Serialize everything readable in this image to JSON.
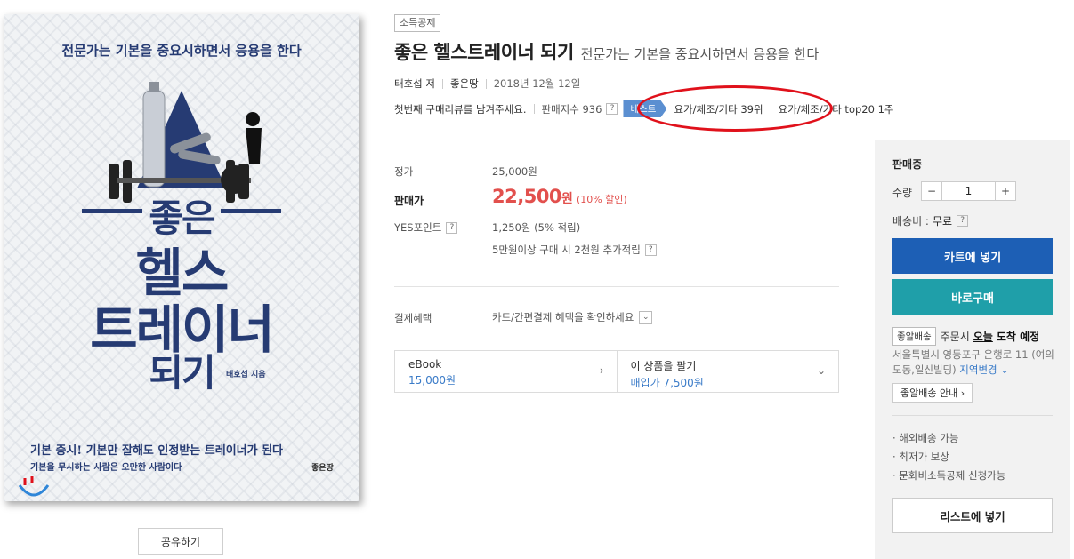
{
  "cover": {
    "subtitle": "전문가는 기본을 중요시하면서 응용을 한다",
    "title_lines": [
      "좋은",
      "헬스",
      "트레이너",
      "되기"
    ],
    "author_credit": "태호섭 지음",
    "tagline": "기본 중시! 기본만 잘해도 인정받는 트레이너가 된다",
    "tagline_sub": "기본을 무시하는 사람은 오만한 사람이다",
    "publisher_logo": "좋은땅",
    "colors": {
      "navy": "#263b73",
      "background": "#f1f3f5"
    }
  },
  "share_label": "공유하기",
  "product": {
    "badge": "소득공제",
    "title": "좋은 헬스트레이너 되기",
    "subtitle": "전문가는 기본을 중요시하면서 응용을 한다",
    "author": "태호섭 저",
    "publisher": "좋은땅",
    "date": "2018년 12월 12일",
    "review_prompt": "첫번째 구매리뷰를 남겨주세요.",
    "sales_index": "판매지수 936",
    "best_label": "베스트",
    "rank_text": "요가/체조/기타 39위",
    "top_text": "요가/체조/기타 top20 1주",
    "help_icon": "?"
  },
  "price": {
    "list_label": "정가",
    "list_value": "25,000원",
    "sale_label": "판매가",
    "sale_value": "22,500",
    "sale_unit": "원",
    "discount": "(10% 할인)",
    "points_label": "YES포인트",
    "points_value": "1,250원 (5% 적립)",
    "points_extra": "5만원이상 구매 시 2천원 추가적립",
    "payment_label": "결제혜택",
    "payment_value": "카드/간편결제 혜택을 확인하세요"
  },
  "formats": [
    {
      "name": "eBook",
      "price": "15,000원",
      "arrow": "›"
    },
    {
      "name": "이 상품을 팔기",
      "price": "매입가 7,500원",
      "arrow": "⌄"
    }
  ],
  "panel": {
    "status": "판매중",
    "qty_label": "수량",
    "qty_minus": "−",
    "qty_value": "1",
    "qty_plus": "+",
    "shipping_label": "배송비 :",
    "shipping_value": "무료",
    "cart_button": "카트에 넣기",
    "buy_button": "바로구매",
    "delivery_tag": "좋알배송",
    "delivery_order": "주문시",
    "delivery_today": "오늘",
    "delivery_arrive": "도착 예정",
    "address": "서울특별시 영등포구 은행로 11 (여의도동,일신빌딩)",
    "address_change": "지역변경 ⌄",
    "guide_button": "좋알배송 안내 ›",
    "bullets": [
      "· 해외배송 가능",
      "· 최저가 보상",
      "· 문화비소득공제 신청가능"
    ],
    "list_button": "리스트에 넣기",
    "colors": {
      "cart": "#1d5fb5",
      "buy": "#1f9fa9",
      "panel_bg": "#f2f2f2"
    }
  },
  "annotation": {
    "oval_color": "#e0111b"
  }
}
